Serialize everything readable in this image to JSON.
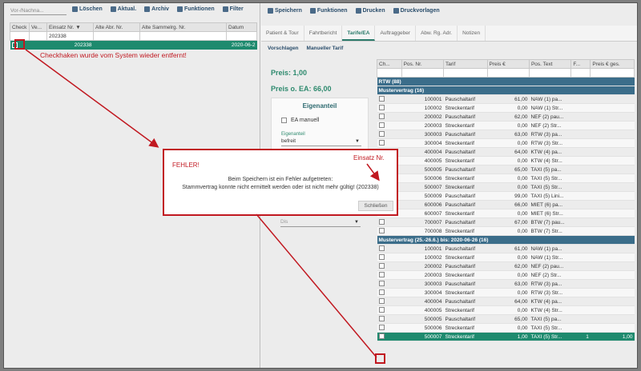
{
  "left": {
    "search_placeholder": "Vor-/Nachna...",
    "toolbar": [
      "Löschen",
      "Aktual.",
      "Archiv",
      "Funktionen",
      "Filter"
    ],
    "columns": [
      "Check",
      "Ve...",
      "Einsatz Nr. ▼",
      "Alte Abr. Nr.",
      "Alte Sammelrg. Nr.",
      "Datum"
    ],
    "filter_value": "202338",
    "row": {
      "einsatz": "202338",
      "datum": "2020-06-2"
    }
  },
  "right": {
    "toolbar": [
      "Speichern",
      "Funktionen",
      "Drucken",
      "Druckvorlagen"
    ],
    "tabs": [
      "Patient & Tour",
      "Fahrtbericht",
      "Tarife/EA",
      "Auftraggeber",
      "Abw. Rg. Adr.",
      "Notizen"
    ],
    "subtoolbar": [
      "Vorschlagen",
      "Manueller Tarif"
    ],
    "preis": "Preis: 1,00",
    "preis_ea": "Preis o. EA: 66,00",
    "eigenanteil": {
      "title": "Eigenanteil",
      "ea_manuell": "EA manuell",
      "label": "Eigenanteil",
      "value": "befreit",
      "dis": "Dis"
    },
    "columns": [
      "Ch...",
      "Pos. Nr.",
      "Tarif",
      "Preis €",
      "Pos. Text",
      "F...",
      "Preis € ges."
    ],
    "groups": {
      "g0": "RTW (88)",
      "g1": "Mustervertrag (16)",
      "g2": "Mustervertrag (25.-26.6.) bis: 2020-06-26 (16)"
    },
    "rows1": [
      [
        "100001",
        "Pauschaltarif",
        "61,00",
        "NAW (1) pa..."
      ],
      [
        "100002",
        "Streckentarif",
        "0,00",
        "NAW (1) Str..."
      ],
      [
        "200002",
        "Pauschaltarif",
        "62,00",
        "NEF (2) pau..."
      ],
      [
        "200003",
        "Streckentarif",
        "0,00",
        "NEF (2) Str..."
      ],
      [
        "300003",
        "Pauschaltarif",
        "63,00",
        "RTW (3) pa..."
      ],
      [
        "300004",
        "Streckentarif",
        "0,00",
        "RTW (3) Str..."
      ],
      [
        "400004",
        "Pauschaltarif",
        "64,00",
        "KTW (4) pa..."
      ],
      [
        "400005",
        "Streckentarif",
        "0,00",
        "KTW (4) Str..."
      ],
      [
        "500005",
        "Pauschaltarif",
        "65,00",
        "TAXI (5) pa..."
      ],
      [
        "500006",
        "Streckentarif",
        "0,00",
        "TAXI (5) Str..."
      ],
      [
        "500007",
        "Streckentarif",
        "0,00",
        "TAXI (5) Str..."
      ],
      [
        "500009",
        "Pauschaltarif",
        "99,00",
        "TAXI (5) Lini..."
      ],
      [
        "600006",
        "Pauschaltarif",
        "66,00",
        "MIET (6) pa..."
      ],
      [
        "600007",
        "Streckentarif",
        "0,00",
        "MIET (6) Str..."
      ],
      [
        "700007",
        "Pauschaltarif",
        "67,00",
        "BTW (7) pau..."
      ],
      [
        "700008",
        "Streckentarif",
        "0,00",
        "BTW (7) Str..."
      ]
    ],
    "rows2": [
      [
        "100001",
        "Pauschaltarif",
        "61,00",
        "NAW (1) pa..."
      ],
      [
        "100002",
        "Streckentarif",
        "0,00",
        "NAW (1) Str..."
      ],
      [
        "200002",
        "Pauschaltarif",
        "62,00",
        "NEF (2) pau..."
      ],
      [
        "200003",
        "Streckentarif",
        "0,00",
        "NEF (2) Str..."
      ],
      [
        "300003",
        "Pauschaltarif",
        "63,00",
        "RTW (3) pa..."
      ],
      [
        "300004",
        "Streckentarif",
        "0,00",
        "RTW (3) Str..."
      ],
      [
        "400004",
        "Pauschaltarif",
        "64,00",
        "KTW (4) pa..."
      ],
      [
        "400005",
        "Streckentarif",
        "0,00",
        "KTW (4) Str..."
      ],
      [
        "500005",
        "Pauschaltarif",
        "65,00",
        "TAXI (5) pa..."
      ],
      [
        "500006",
        "Streckentarif",
        "0,00",
        "TAXI (5) Str..."
      ]
    ],
    "sel_row": {
      "pos": "500007",
      "tarif": "Streckentarif",
      "preis": "1,00",
      "text": "TAXI (5) Str...",
      "f": "1",
      "ges": "1,00"
    }
  },
  "dialog": {
    "title": "FEHLER!",
    "line1": "Beim Speichern ist ein Fehler aufgetreten:",
    "line2": "Stammvertrag konnte nicht ermittelt werden oder ist nicht mehr gültig! (202338)",
    "close": "Schließen"
  },
  "annotations": {
    "checkhaken": "Checkhaken wurde vom System wieder entfernt!",
    "einsatz_nr": "Einsatz Nr."
  },
  "colors": {
    "accent": "#2e8a6e",
    "error": "#c11820",
    "group": "#3b6d8a"
  }
}
